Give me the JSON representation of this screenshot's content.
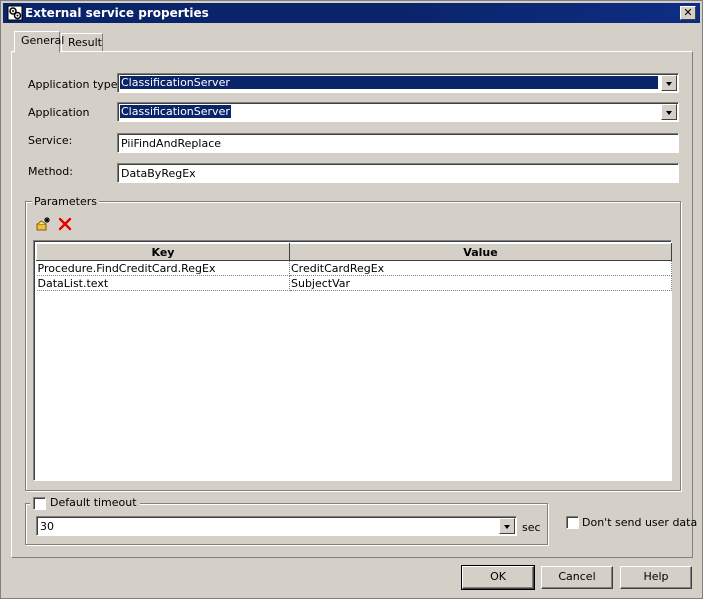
{
  "window": {
    "title": "External service properties",
    "close_glyph": "✕"
  },
  "tabs": [
    {
      "label": "General",
      "active": true
    },
    {
      "label": "Result",
      "active": false
    }
  ],
  "form": {
    "application_type": {
      "label": "Application type:",
      "value": "ClassificationServer"
    },
    "application": {
      "label": "Application",
      "value": "ClassificationServer"
    },
    "service": {
      "label": "Service:",
      "value": "PiiFindAndReplace"
    },
    "method": {
      "label": "Method:",
      "value": "DataByRegEx"
    }
  },
  "parameters": {
    "title": "Parameters",
    "toolbar": {
      "add_icon": "add-parameter-icon",
      "delete_icon": "delete-icon"
    },
    "columns": [
      "Key",
      "Value"
    ],
    "rows": [
      {
        "key": "Procedure.FindCreditCard.RegEx",
        "value": "CreditCardRegEx"
      },
      {
        "key": "DataList.text",
        "value": "SubjectVar"
      }
    ]
  },
  "timeout": {
    "checkbox_label": "Default timeout",
    "checked": false,
    "value": "30",
    "unit": "sec"
  },
  "dont_send_user_data": {
    "label": "Don't send user data",
    "checked": false
  },
  "buttons": {
    "ok": "OK",
    "cancel": "Cancel",
    "help": "Help"
  },
  "colors": {
    "titlebar": "#0a246a",
    "face": "#d4d0c8",
    "selection": "#0a246a",
    "delete_red": "#e00000"
  }
}
